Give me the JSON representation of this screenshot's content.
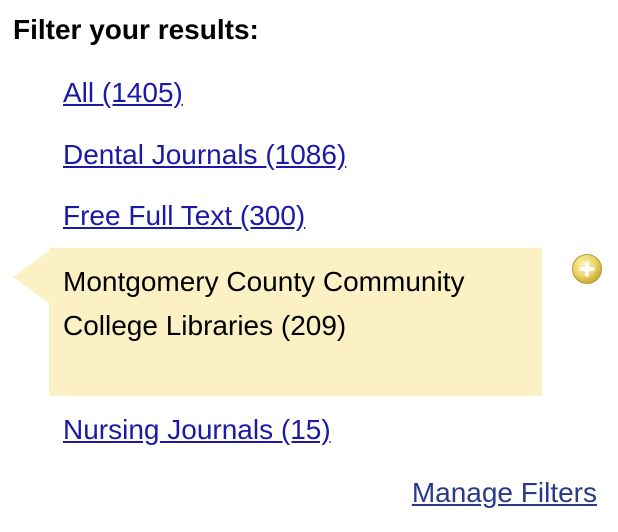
{
  "filter_panel": {
    "heading": "Filter your results:",
    "filters": [
      {
        "label": "All (1405)"
      },
      {
        "label": "Dental Journals (1086)"
      },
      {
        "label": "Free Full Text (300)"
      },
      {
        "label": "Montgomery County Community College Libraries (209)",
        "selected": true
      },
      {
        "label": "Nursing Journals (15)"
      }
    ],
    "selected_icon": "add-circle-icon",
    "manage_label": "Manage Filters"
  },
  "colors": {
    "link": "#1a1aa6",
    "manage_link": "#2a3a88",
    "selected_bg": "#fcf0c5",
    "icon": "#e8d36a"
  }
}
